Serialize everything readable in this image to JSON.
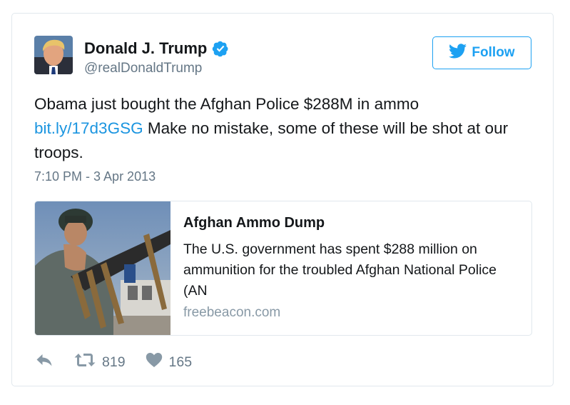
{
  "user": {
    "name": "Donald J. Trump",
    "handle": "@realDonaldTrump",
    "verified_icon": "verified-badge-icon"
  },
  "follow_button": {
    "label": "Follow",
    "icon": "twitter-bird-icon"
  },
  "tweet": {
    "text_part1": "Obama just bought the Afghan Police $288M in ammo",
    "link": "bit.ly/17d3GSG",
    "text_part2": " Make no mistake, some of these will be shot at our troops.",
    "timestamp": "7:10 PM - 3 Apr 2013"
  },
  "link_card": {
    "title": "Afghan Ammo Dump",
    "description": "The U.S. government has spent $288 million on ammunition for the troubled Afghan National Police (AN",
    "domain": "freebeacon.com"
  },
  "actions": {
    "reply_icon": "reply-icon",
    "retweet_icon": "retweet-icon",
    "retweet_count": "819",
    "like_icon": "heart-icon",
    "like_count": "165"
  },
  "colors": {
    "accent": "#1da1f2",
    "link": "#1b95e0",
    "muted": "#657786",
    "border": "#e1e8ed"
  }
}
